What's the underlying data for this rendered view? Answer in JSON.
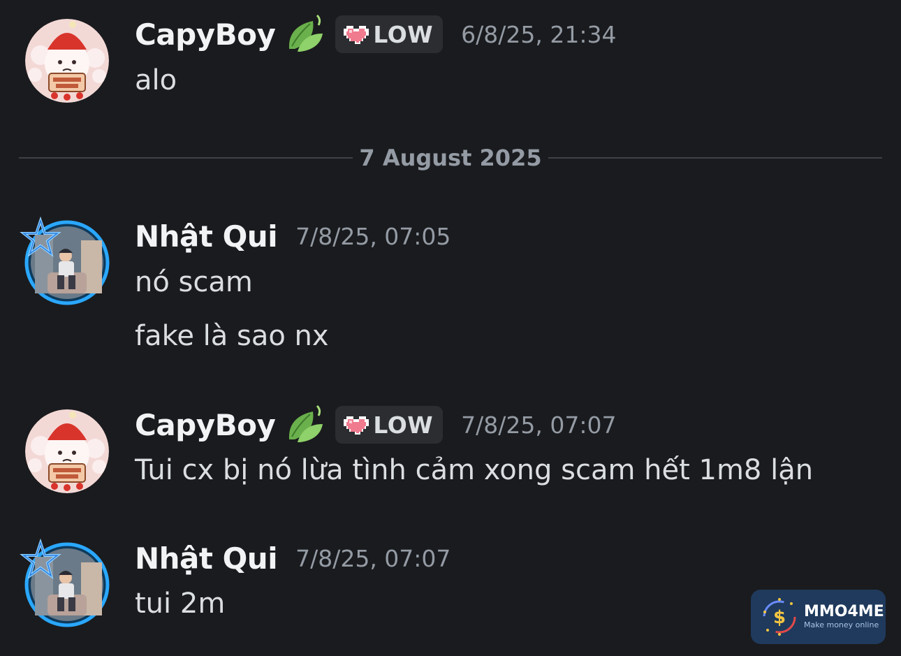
{
  "messages": [
    {
      "author": "CapyBoy",
      "badge": "LOW",
      "timestamp": "6/8/25, 21:34",
      "lines": [
        "alo"
      ]
    },
    {
      "author": "Nhật Qui",
      "timestamp": "7/8/25, 07:05",
      "lines": [
        "nó scam",
        "fake là sao nx"
      ]
    },
    {
      "author": "CapyBoy",
      "badge": "LOW",
      "timestamp": "7/8/25, 07:07",
      "lines": [
        "Tui cx bị nó lừa tình cảm xong scam hết 1m8 lận"
      ]
    },
    {
      "author": "Nhật Qui",
      "timestamp": "7/8/25, 07:07",
      "lines": [
        "tui 2m"
      ]
    }
  ],
  "date_divider": "7 August 2025",
  "watermark": {
    "brand": "MMO4ME",
    "tagline": "Make money online"
  },
  "colors": {
    "background": "#1a1b1e",
    "text": "#dbdee1",
    "muted": "#949ba4",
    "badge_bg": "#2b2d31",
    "avatar_ring": "#2aa8ff"
  },
  "icons": {
    "author_flair": "leaf-icon",
    "badge_icon": "pixel-heart-icon",
    "avatar_decoration": "star-icon"
  }
}
